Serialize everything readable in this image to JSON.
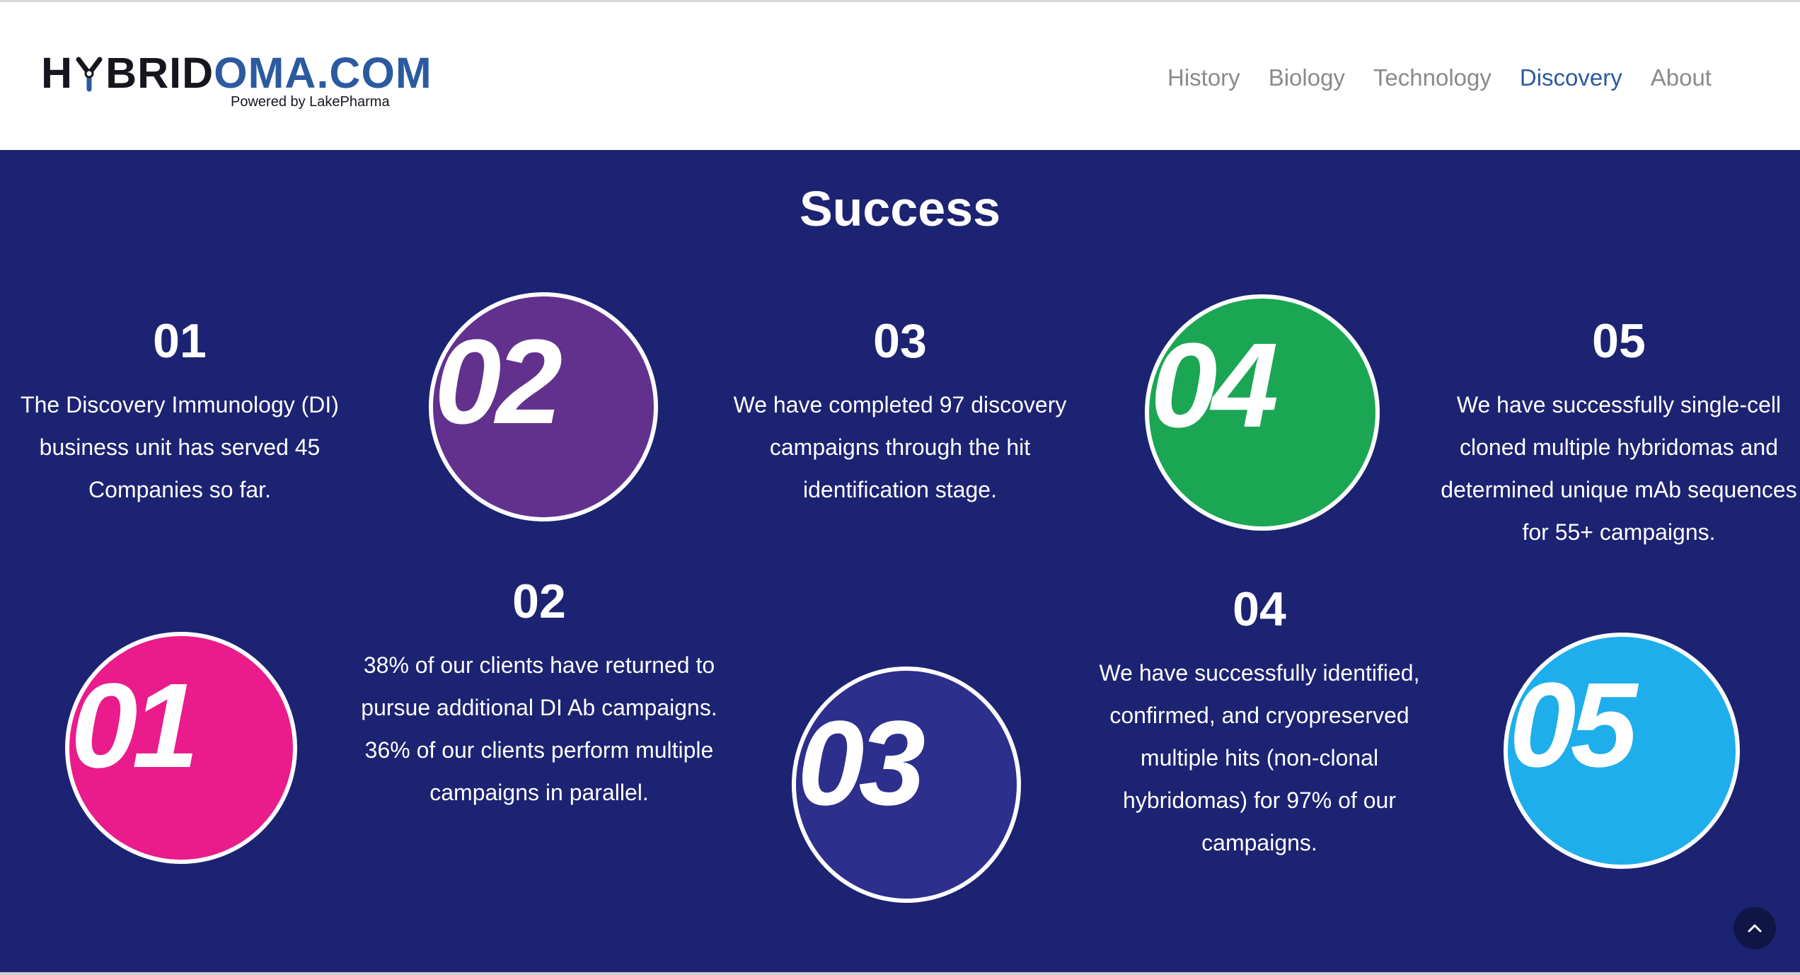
{
  "brand": {
    "name_dark_1": "H",
    "name_dark_2": "BRID",
    "name_blue": "OMA.COM",
    "tagline": "Powered by LakePharma",
    "dark_color": "#15161e",
    "blue_color": "#2b5aa0"
  },
  "nav": {
    "items": [
      {
        "label": "History",
        "active": false
      },
      {
        "label": "Biology",
        "active": false
      },
      {
        "label": "Technology",
        "active": false
      },
      {
        "label": "Discovery",
        "active": true
      },
      {
        "label": "About",
        "active": false
      }
    ]
  },
  "section": {
    "title": "Success",
    "background": "#1c2372"
  },
  "stats": [
    {
      "number": "01",
      "text": [
        "The Discovery Immunology (DI)",
        "business unit has served 45",
        "Companies so far."
      ]
    },
    {
      "number": "02",
      "text": [
        "38% of our clients have returned to",
        "pursue additional DI Ab campaigns.",
        "36% of our clients perform multiple",
        "campaigns in parallel."
      ]
    },
    {
      "number": "03",
      "text": [
        "We have completed 97 discovery",
        "campaigns through the hit",
        "identification stage."
      ]
    },
    {
      "number": "04",
      "text": [
        "We have successfully identified,",
        "confirmed, and cryopreserved",
        "multiple hits (non-clonal",
        "hybridomas) for 97% of our",
        "campaigns."
      ]
    },
    {
      "number": "05",
      "text": [
        "We have successfully single-cell",
        "cloned multiple hybridomas and",
        "determined unique mAb sequences",
        "for 55+ campaigns."
      ]
    }
  ],
  "badges": [
    {
      "label": "01",
      "color": "#ea1b8a"
    },
    {
      "label": "02",
      "color": "#62318e"
    },
    {
      "label": "03",
      "color": "#2c2f8c"
    },
    {
      "label": "04",
      "color": "#1ba654"
    },
    {
      "label": "05",
      "color": "#1eaeeb"
    }
  ],
  "scroll_top": {
    "icon": "chevron-up-icon"
  }
}
